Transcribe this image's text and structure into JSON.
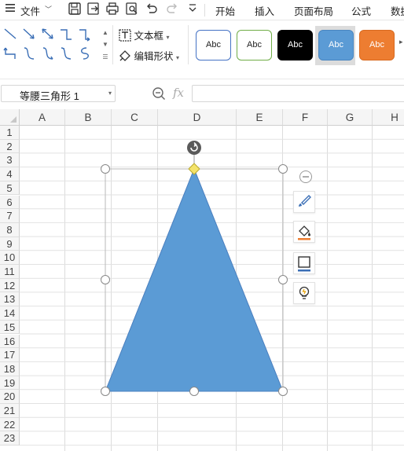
{
  "menu": {
    "file_label": "文件",
    "tabs": [
      "开始",
      "插入",
      "页面布局",
      "公式",
      "数据"
    ]
  },
  "ribbon": {
    "text_box_label": "文本框",
    "edit_shape_label": "编辑形状",
    "shape_styles": [
      {
        "label": "Abc",
        "fill": "#ffffff",
        "border": "#4472c4",
        "text": "#222222"
      },
      {
        "label": "Abc",
        "fill": "#ffffff",
        "border": "#70ad47",
        "text": "#222222"
      },
      {
        "label": "Abc",
        "fill": "#000000",
        "border": "#000000",
        "text": "#ffffff"
      },
      {
        "label": "Abc",
        "fill": "#5b9bd5",
        "border": "#4a86c0",
        "text": "#ffffff"
      },
      {
        "label": "Abc",
        "fill": "#ed7d31",
        "border": "#d86a20",
        "text": "#ffffff"
      }
    ]
  },
  "formula_bar": {
    "name_box_value": "等腰三角形 1",
    "fx_label": "fx",
    "formula_value": ""
  },
  "sheet": {
    "columns": [
      "A",
      "B",
      "C",
      "D",
      "E",
      "F",
      "G",
      "H"
    ],
    "rows": [
      "1",
      "2",
      "3",
      "4",
      "5",
      "6",
      "7",
      "8",
      "9",
      "10",
      "11",
      "12",
      "13",
      "14",
      "15",
      "16",
      "17",
      "18",
      "19",
      "20",
      "21",
      "22",
      "23"
    ]
  },
  "shape": {
    "type": "isosceles-triangle",
    "fill": "#5b9bd5",
    "outline": "#4a7fbf"
  },
  "colors": {
    "accent": "#4472c4",
    "header_bg": "#f5f5f5",
    "grid_line": "#dcdcdc"
  },
  "icons": [
    "menu-icon",
    "save-icon",
    "export-icon",
    "print-icon",
    "print-preview-icon",
    "undo-icon",
    "redo-icon",
    "more-icon",
    "zoom-icon",
    "rotate-handle-icon",
    "collapse-icon",
    "brush-icon",
    "fill-bucket-icon",
    "outline-icon",
    "lightbulb-icon"
  ]
}
